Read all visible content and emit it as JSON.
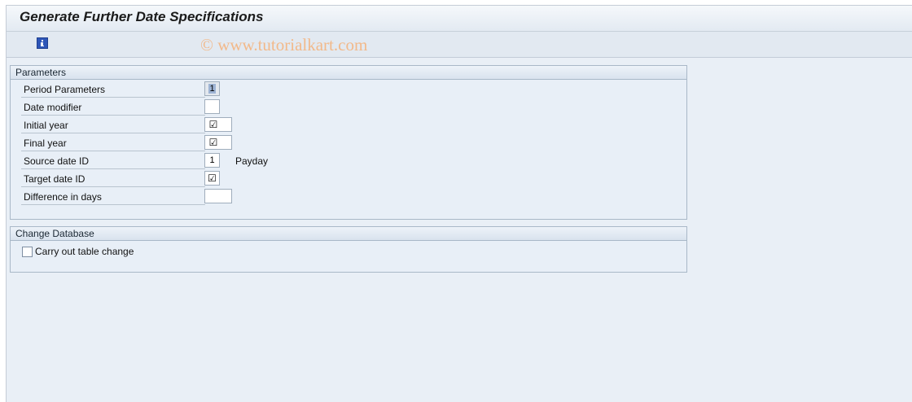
{
  "window": {
    "title": "Generate Further Date Specifications",
    "watermark": "© www.tutorialkart.com"
  },
  "toolbar": {
    "info_icon": "info-icon"
  },
  "parameters": {
    "header": "Parameters",
    "rows": [
      {
        "label": "Period Parameters",
        "value": "1"
      },
      {
        "label": "Date modifier",
        "value": ""
      },
      {
        "label": "Initial year",
        "value": "☑"
      },
      {
        "label": "Final year",
        "value": "☑"
      },
      {
        "label": "Source date ID",
        "value": "1",
        "description": "Payday"
      },
      {
        "label": "Target date ID",
        "value": "☑"
      },
      {
        "label": "Difference in days",
        "value": ""
      }
    ]
  },
  "change_db": {
    "header": "Change Database",
    "checkbox_label": "Carry out table change",
    "checked": false
  }
}
